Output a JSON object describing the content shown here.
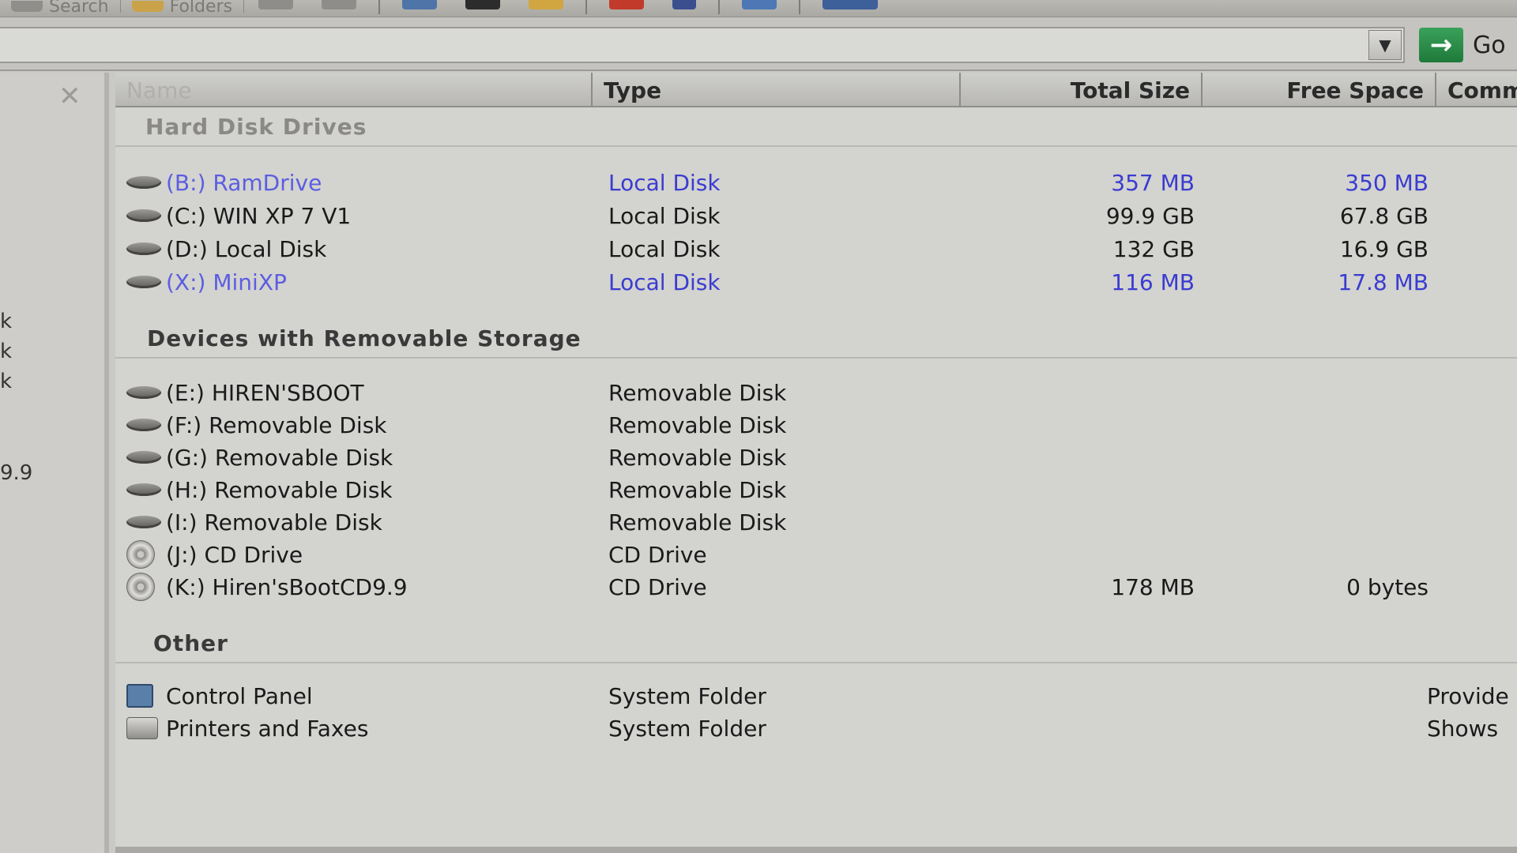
{
  "toolbar": {
    "search_label": "Search",
    "folders_label": "Folders"
  },
  "address": {
    "go_label": "Go"
  },
  "left_pane": {
    "fragments": [
      "k",
      "k",
      "k",
      "9.9"
    ]
  },
  "columns": {
    "name": "Name",
    "type": "Type",
    "total_size": "Total Size",
    "free_space": "Free Space",
    "comments": "Comme"
  },
  "groups": {
    "hard_disks": {
      "title": "Hard Disk Drives",
      "items": [
        {
          "name": "(B:) RamDrive",
          "type": "Local Disk",
          "total": "357 MB",
          "free": "350 MB"
        },
        {
          "name": "(C:) WIN XP 7  V1",
          "type": "Local Disk",
          "total": "99.9 GB",
          "free": "67.8 GB"
        },
        {
          "name": "(D:) Local Disk",
          "type": "Local Disk",
          "total": "132 GB",
          "free": "16.9 GB"
        },
        {
          "name": "(X:) MiniXP",
          "type": "Local Disk",
          "total": "116 MB",
          "free": "17.8 MB"
        }
      ]
    },
    "removable": {
      "title": "Devices with Removable Storage",
      "items": [
        {
          "name": "(E:) HIREN'SBOOT",
          "type": "Removable Disk"
        },
        {
          "name": "(F:) Removable Disk",
          "type": "Removable Disk"
        },
        {
          "name": "(G:) Removable Disk",
          "type": "Removable Disk"
        },
        {
          "name": "(H:) Removable Disk",
          "type": "Removable Disk"
        },
        {
          "name": "(I:) Removable Disk",
          "type": "Removable Disk"
        },
        {
          "name": "(J:) CD Drive",
          "type": "CD Drive"
        },
        {
          "name": "(K:) Hiren'sBootCD9.9",
          "type": "CD Drive",
          "total": "178 MB",
          "free": "0 bytes"
        }
      ]
    },
    "other": {
      "title": "Other",
      "items": [
        {
          "name": "Control Panel",
          "type": "System Folder",
          "comment": "Provide"
        },
        {
          "name": "Printers and Faxes",
          "type": "System Folder",
          "comment": "Shows"
        }
      ]
    }
  },
  "colors": {
    "highlight_text": "#3a3cd0",
    "go_button": "#2a8c48"
  },
  "icons": {
    "drive": "hard-drive-icon",
    "cd": "cd-drive-icon",
    "control_panel": "control-panel-icon",
    "printer": "printer-icon"
  }
}
